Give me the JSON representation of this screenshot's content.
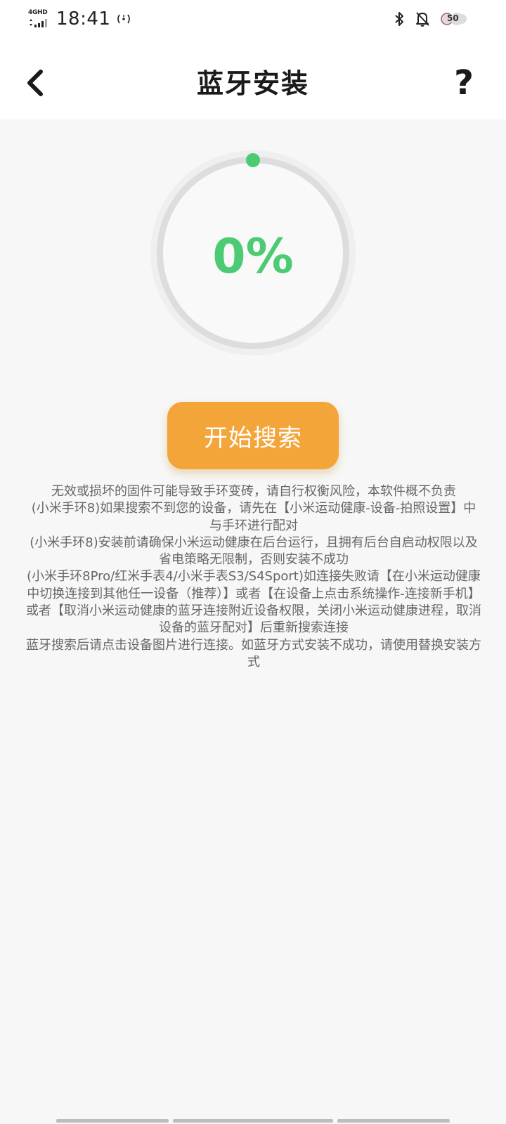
{
  "status_bar": {
    "network": "4GHD",
    "time": "18:41",
    "battery": "50"
  },
  "header": {
    "title": "蓝牙安装",
    "help_label": "?"
  },
  "progress": {
    "percent": 0,
    "label": "0%"
  },
  "start_button_label": "开始搜索",
  "notes": [
    "无效或损坏的固件可能导致手环变砖，请自行权衡风险，本软件概不负责",
    "(小米手环8)如果搜索不到您的设备，请先在【小米运动健康-设备-拍照设置】中与手环进行配对",
    "(小米手环8)安装前请确保小米运动健康在后台运行，且拥有后台自启动权限以及省电策略无限制，否则安装不成功",
    "(小米手环8Pro/红米手表4/小米手表S3/S4Sport)如连接失败请【在小米运动健康中切换连接到其他任一设备（推荐）】或者【在设备上点击系统操作-连接新手机】或者【取消小米运动健康的蓝牙连接附近设备权限，关闭小米运动健康进程，取消设备的蓝牙配对】后重新搜索连接",
    "蓝牙搜索后请点击设备图片进行连接。如蓝牙方式安装不成功，请使用替换安装方式"
  ],
  "colors": {
    "accent_green": "#4dcb74",
    "button_orange": "#f4a53a",
    "track_gray": "#dddddd"
  },
  "icons": {
    "back": "chevron-left-icon",
    "bluetooth": "bluetooth-icon",
    "mute": "bell-off-icon",
    "signal": "signal-bars-icon",
    "hotspot": "hotspot-icon",
    "battery": "battery-icon"
  }
}
